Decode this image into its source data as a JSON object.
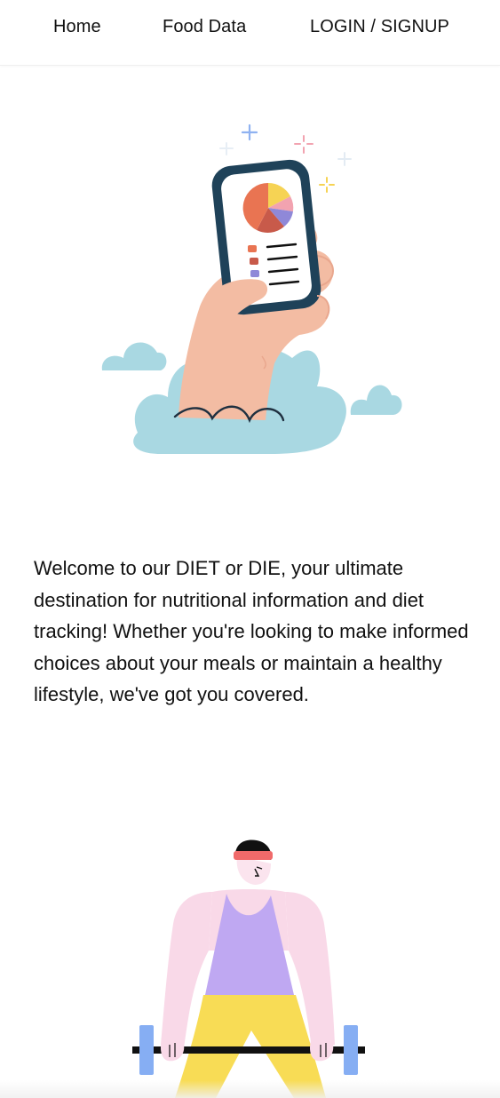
{
  "nav": {
    "home": "Home",
    "food_data": "Food Data",
    "login_signup": "LOGIN / SIGNUP"
  },
  "intro": {
    "text": "Welcome to our DIET or DIE, your ultimate destination for nutritional information and diet tracking! Whether you're looking to make informed choices about your meals or maintain a healthy lifestyle, we've got you covered."
  },
  "illustrations": {
    "hero": "hand-holding-phone-illustration",
    "fitness": "weightlifter-illustration"
  },
  "colors": {
    "cloud": "#a9d8e2",
    "skin": "#f3bca3",
    "phone_frame": "#1f4259",
    "pie_orange": "#e97452",
    "pie_yellow": "#f6d354",
    "pie_pink": "#f2a3b0",
    "pie_purple": "#8f88d8",
    "pie_red": "#c85a4a",
    "shirt_purple": "#bfa8f2",
    "sleeve_pink": "#f9d9e8",
    "pants_yellow": "#f8dc55",
    "weight_blue": "#86aef3",
    "headband_red": "#f06a6a"
  }
}
